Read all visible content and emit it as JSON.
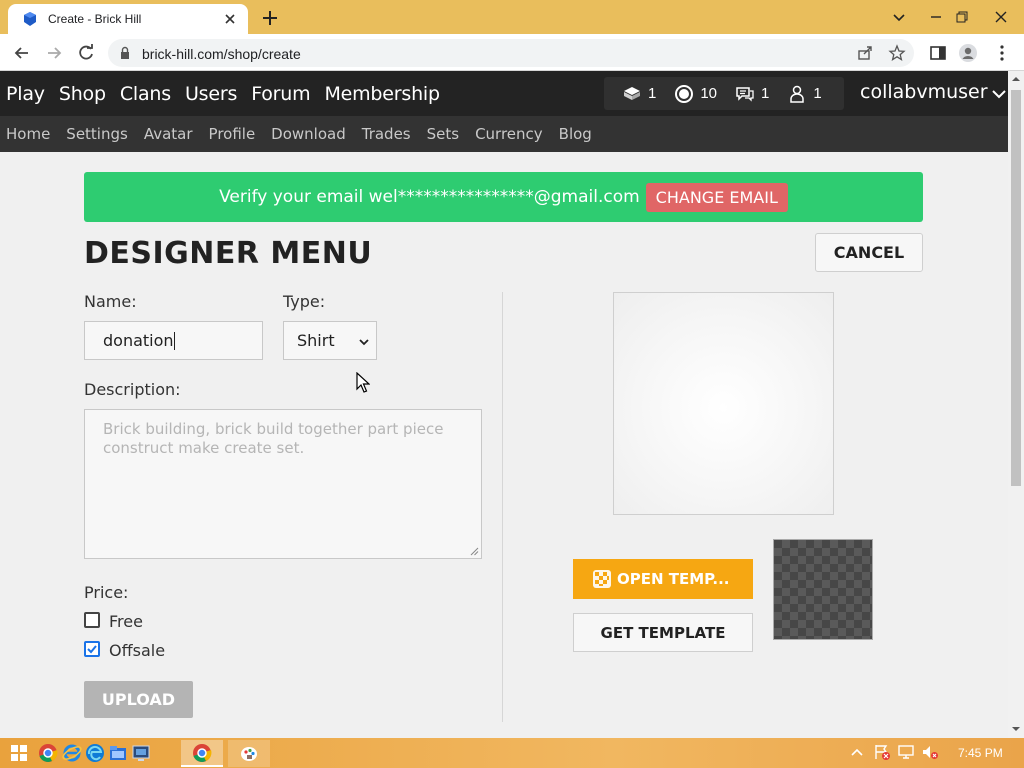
{
  "browser": {
    "tab_title": "Create - Brick Hill",
    "url": "brick-hill.com/shop/create"
  },
  "topnav": {
    "links": [
      "Play",
      "Shop",
      "Clans",
      "Users",
      "Forum",
      "Membership"
    ],
    "stats": {
      "bricks": "1",
      "bits": "10",
      "messages": "1",
      "friends": "1"
    },
    "username": "collabvmuser"
  },
  "subnav": {
    "links": [
      "Home",
      "Settings",
      "Avatar",
      "Profile",
      "Download",
      "Trades",
      "Sets",
      "Currency",
      "Blog"
    ]
  },
  "banner": {
    "message": "Verify your email wel****************@gmail.com",
    "button": "CHANGE EMAIL"
  },
  "page": {
    "title": "DESIGNER MENU",
    "cancel": "CANCEL"
  },
  "form": {
    "name_label": "Name:",
    "name_value": "donation",
    "type_label": "Type:",
    "type_value": "Shirt",
    "description_label": "Description:",
    "description_placeholder": "Brick building, brick build together part piece construct make create set.",
    "price_label": "Price:",
    "free_label": "Free",
    "free_checked": false,
    "offsale_label": "Offsale",
    "offsale_checked": true,
    "upload": "UPLOAD"
  },
  "template": {
    "open": "OPEN TEMP...",
    "get": "GET TEMPLATE"
  },
  "taskbar": {
    "time": "7:45 PM"
  },
  "colors": {
    "banner_green": "#2ecc71",
    "change_email_red": "#e06666",
    "open_template_orange": "#f6a712",
    "header_dark": "#232323"
  }
}
